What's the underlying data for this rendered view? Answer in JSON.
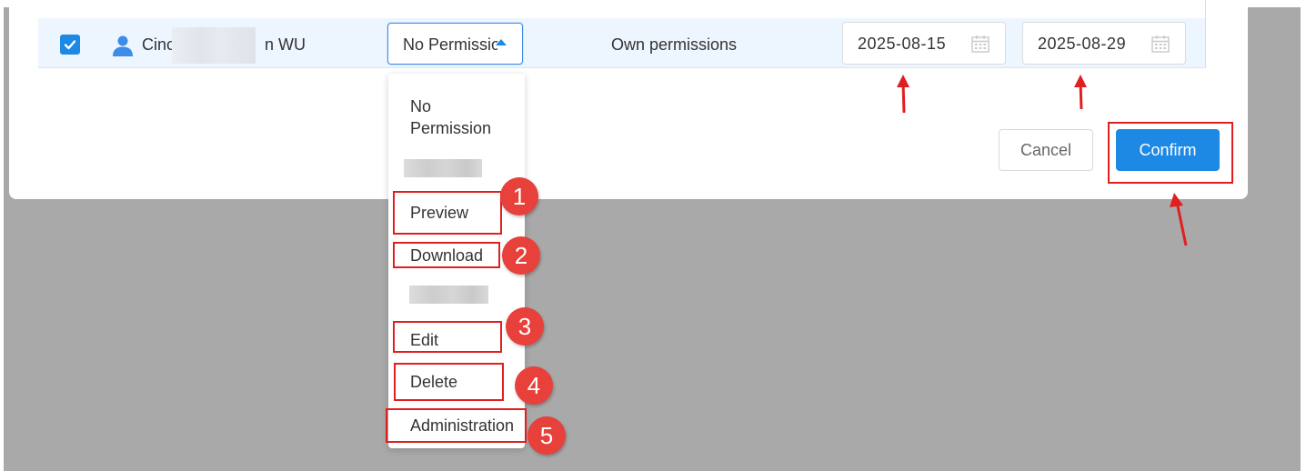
{
  "row": {
    "name_prefix": "Cinc",
    "name_suffix": "n WU",
    "permission_select": "No Permissio",
    "inherited_permission": "Own permissions",
    "start_date": "2025-08-15",
    "end_date": "2025-08-29"
  },
  "dropdown": {
    "options": [
      "No Permission",
      "Preview",
      "Download",
      "Edit",
      "Delete",
      "Administration"
    ]
  },
  "buttons": {
    "cancel": "Cancel",
    "confirm": "Confirm"
  },
  "annotations": {
    "badges": [
      "1",
      "2",
      "3",
      "4",
      "5"
    ]
  },
  "colors": {
    "accent": "#1e88e5",
    "highlight": "#e01f1f",
    "badge": "#e8403a",
    "backdrop": "#a9a9a9"
  },
  "icons": {
    "checkbox": "checkmark-icon",
    "user": "user-icon",
    "caret": "caret-up-icon",
    "calendar": "calendar-icon"
  }
}
